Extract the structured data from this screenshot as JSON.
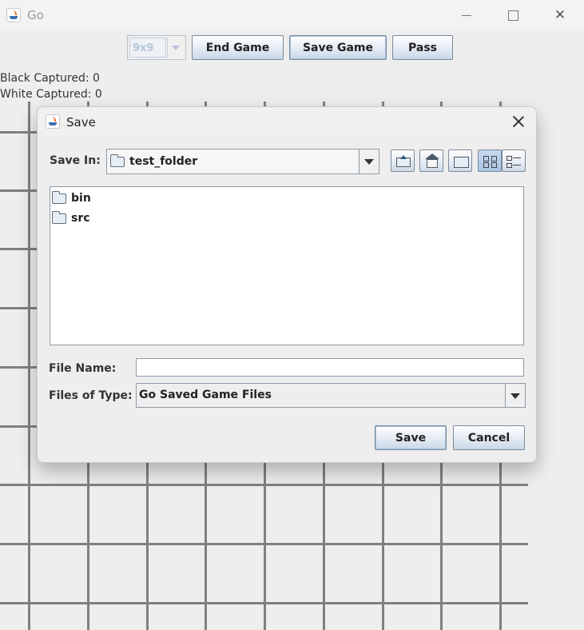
{
  "window": {
    "title": "Go",
    "icon": "java-icon"
  },
  "toolbar": {
    "board_size": "9x9",
    "end_game": "End Game",
    "save_game": "Save Game",
    "pass": "Pass"
  },
  "status": {
    "black_captured": "Black Captured: 0",
    "white_captured": "White Captured: 0"
  },
  "dialog": {
    "title": "Save",
    "save_in_label": "Save In:",
    "save_in_value": "test_folder",
    "toolbar_icons": [
      "up-one-level-icon",
      "home-icon",
      "new-folder-icon",
      "list-view-icon",
      "details-view-icon"
    ],
    "files": [
      {
        "name": "bin",
        "icon": "folder-icon"
      },
      {
        "name": "src",
        "icon": "folder-icon"
      }
    ],
    "file_name_label": "File Name:",
    "file_name_value": "",
    "files_of_type_label": "Files of Type:",
    "files_of_type_value": "Go Saved Game Files",
    "save_button": "Save",
    "cancel_button": "Cancel"
  },
  "colors": {
    "background": "#eeeeee",
    "grid_line": "#808080",
    "button_gradient_bottom": "#c9d8ea"
  }
}
